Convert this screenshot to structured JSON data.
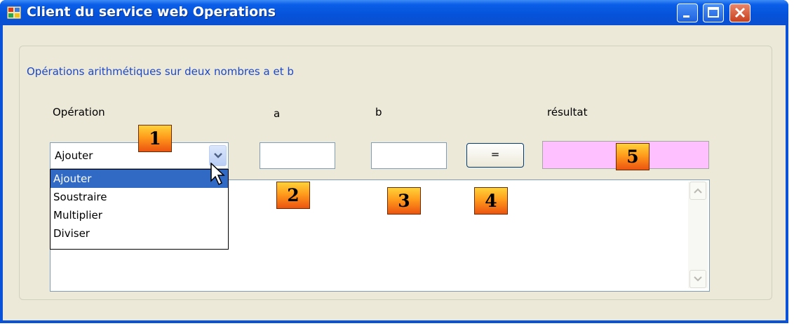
{
  "window": {
    "title": "Client du service web Operations"
  },
  "group": {
    "title": "Opérations arithmétiques sur deux nombres a et b"
  },
  "labels": {
    "operation": "Opération",
    "a": "a",
    "b": "b",
    "result": "résultat"
  },
  "operation_combo": {
    "selected": "Ajouter",
    "options": [
      "Ajouter",
      "Soustraire",
      "Multiplier",
      "Diviser"
    ],
    "highlighted_index": 0
  },
  "inputs": {
    "a": "",
    "b": ""
  },
  "equals_button": {
    "label": "="
  },
  "result_field": {
    "value": "",
    "background": "#ffc0ff"
  },
  "badges": [
    "1",
    "2",
    "3",
    "4",
    "5"
  ],
  "colors": {
    "titlebar": "#0a53d8",
    "group_title": "#1c48c8",
    "selection": "#316ac5",
    "badge_orange": "#ff9c1c"
  }
}
